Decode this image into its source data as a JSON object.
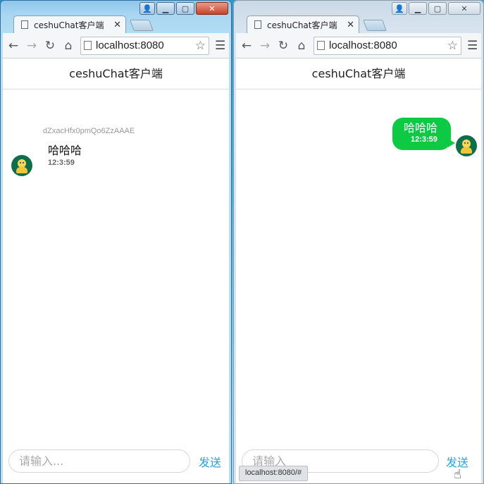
{
  "left_window": {
    "tab_title": "ceshuChat客户端",
    "url": "localhost:8080",
    "app_title": "ceshuChat客户端",
    "message": {
      "username": "dZxacHfx0pmQo6ZzAAAE",
      "text": "哈哈哈",
      "time": "12:3:59"
    },
    "input_placeholder": "请输入...",
    "send_label": "发送"
  },
  "right_window": {
    "tab_title": "ceshuChat客户端",
    "url": "localhost:8080",
    "app_title": "ceshuChat客户端",
    "message": {
      "text": "哈哈哈",
      "time": "12:3:59"
    },
    "input_placeholder": "请输入",
    "send_label": "发送",
    "status_url": "localhost:8080/#"
  },
  "colors": {
    "bubble_green": "#0ec944",
    "send_blue": "#2aa3d8",
    "avatar_green": "#0f6e4a"
  },
  "icons": [
    "document-icon",
    "back-icon",
    "forward-icon",
    "reload-icon",
    "home-icon",
    "page-icon",
    "star-icon",
    "menu-icon",
    "close-icon",
    "minimize-icon",
    "maximize-icon",
    "user-icon",
    "hand-cursor-icon"
  ]
}
